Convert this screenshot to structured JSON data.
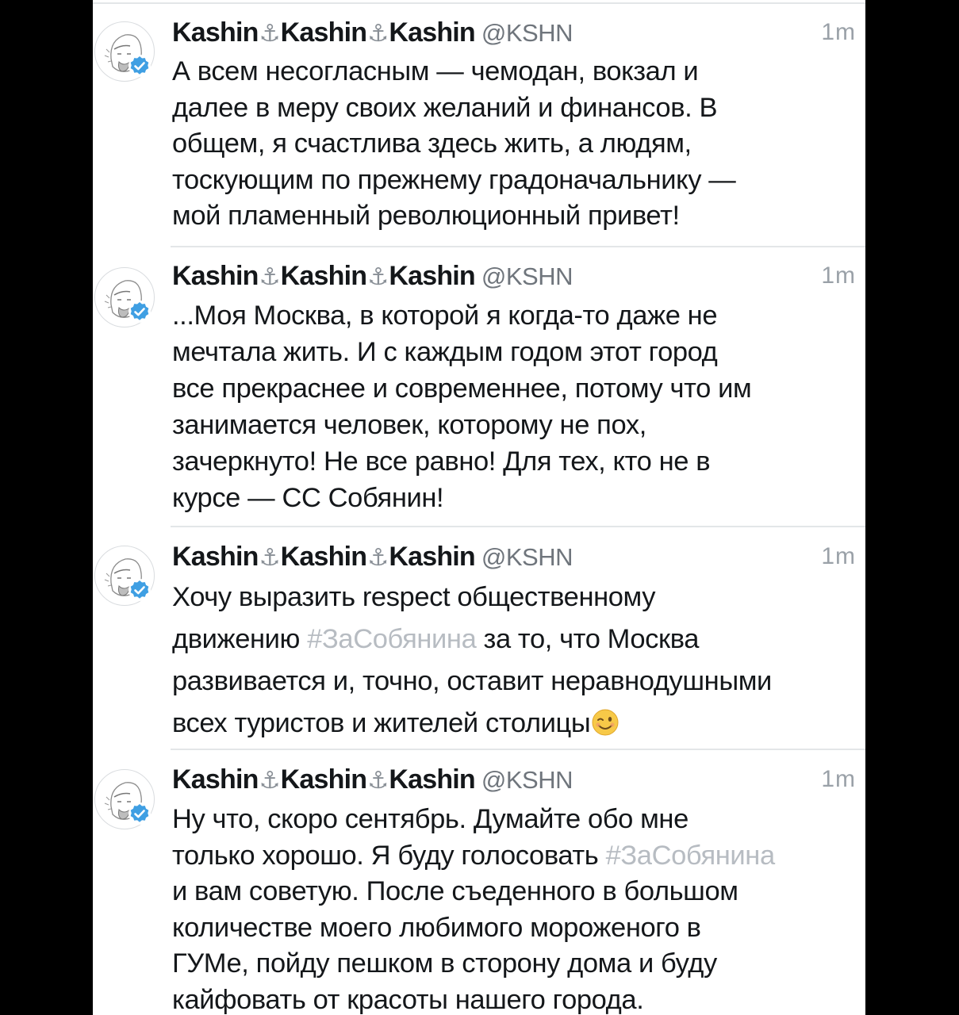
{
  "tweets": [
    {
      "name_parts": [
        "Kashin",
        "Kashin",
        "Kashin"
      ],
      "anchor": "⚓",
      "handle": "@KSHN",
      "time": "1m",
      "lines": [
        "А всем несогласным — чемодан, вокзал и",
        "далее в меру своих желаний и финансов. В",
        "общем, я счастлива здесь жить, а людям,",
        "тоскующим по прежнему градоначальнику —",
        "мой пламенный революционный привет!"
      ]
    },
    {
      "name_parts": [
        "Kashin",
        "Kashin",
        "Kashin"
      ],
      "anchor": "⚓",
      "handle": "@KSHN",
      "time": "1m",
      "lines": [
        "...Моя Москва, в которой я когда-то даже не",
        "мечтала жить. И с каждым годом этот город",
        "все прекраснее и современнее, потому что им",
        "занимается человек, которому не пох,",
        "зачеркнуто! Не все равно! Для тех, кто не в",
        "курсе — СС Собянин!"
      ]
    },
    {
      "name_parts": [
        "Kashin",
        "Kashin",
        "Kashin"
      ],
      "anchor": "⚓",
      "handle": "@KSHN",
      "time": "1m",
      "line1": "Хочу выразить respect общественному",
      "line2_pre": "движению ",
      "line2_hashtag": "#ЗаСобянина",
      "line2_post": " за то, что Москва",
      "line3": "развивается и, точно, оставит неравнодушными",
      "line4": "всех туристов и жителей столицы",
      "emoji": "winking-face-emoji"
    },
    {
      "name_parts": [
        "Kashin",
        "Kashin",
        "Kashin"
      ],
      "anchor": "⚓",
      "handle": "@KSHN",
      "time": "1m",
      "line1": "Ну что, скоро сентябрь. Думайте обо мне",
      "line2_pre": "только хорошо. Я буду голосовать ",
      "line2_hashtag": "#ЗаСобянина",
      "line3": "и вам советую. После съеденного в большом",
      "line4": "количестве моего любимого мороженого в",
      "line5": "ГУМе, пойду пешком в сторону дома и буду",
      "line6": "кайфовать от красоты нашего города."
    }
  ],
  "colors": {
    "text": "#14171a",
    "handle": "#6f757c",
    "time": "#9aa1a8",
    "hashtag": "#b7bcc2",
    "verified": "#3f9fe3",
    "divider": "#e3e6e8"
  }
}
